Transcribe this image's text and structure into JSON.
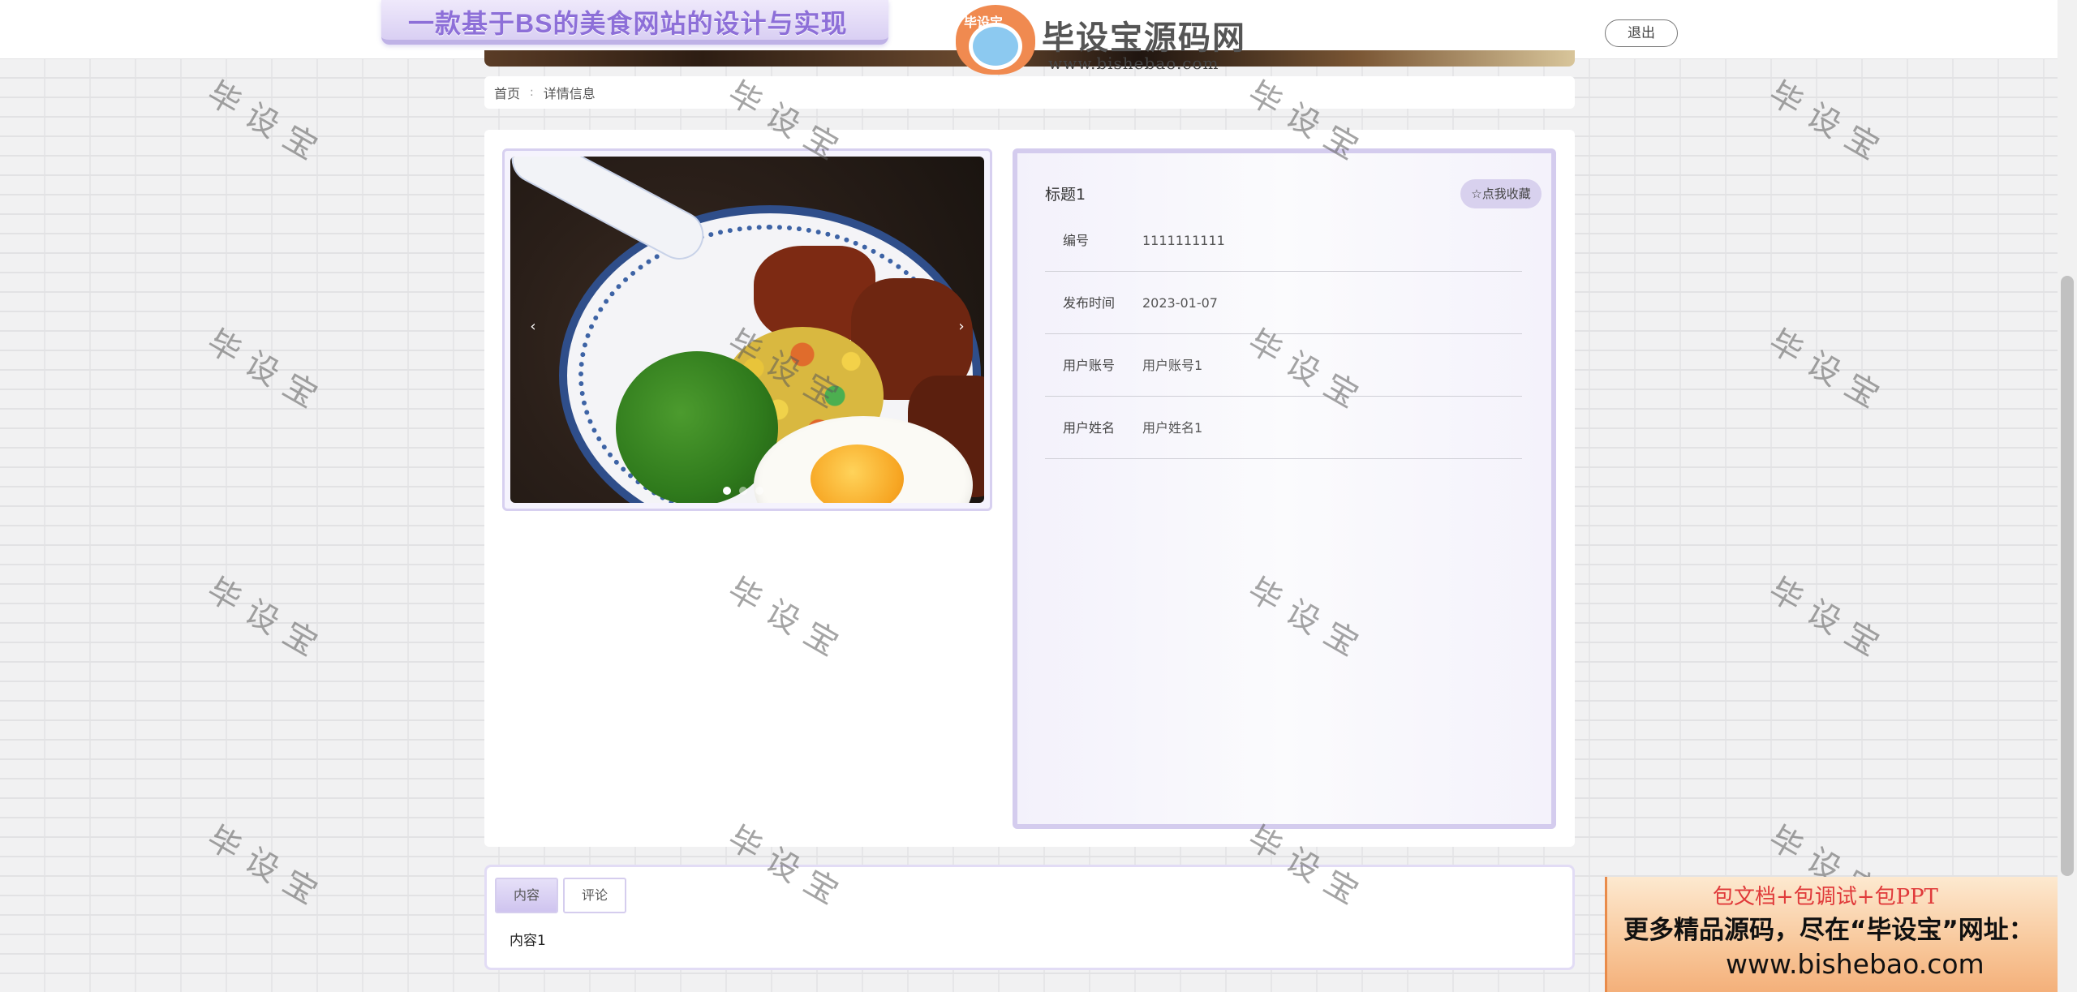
{
  "header": {
    "site_title": "一款基于BS的美食网站的设计与实现",
    "logout_label": "退出"
  },
  "watermark_logo": {
    "tag": "毕设宝",
    "name": "毕设宝源码网",
    "url": "www.bishebao.com"
  },
  "breadcrumb": {
    "home": "首页",
    "separator": ":",
    "current": "详情信息"
  },
  "carousel": {
    "prev_icon": "‹",
    "next_icon": "›",
    "slide_count": 3,
    "active_slide": 1
  },
  "detail": {
    "title": "标题1",
    "favorite_label": "☆点我收藏",
    "fields": [
      {
        "label": "编号",
        "value": "1111111111"
      },
      {
        "label": "发布时间",
        "value": "2023-01-07"
      },
      {
        "label": "用户账号",
        "value": "用户账号1"
      },
      {
        "label": "用户姓名",
        "value": "用户姓名1"
      }
    ]
  },
  "tabs": {
    "items": [
      {
        "label": "内容",
        "active": true
      },
      {
        "label": "评论",
        "active": false
      }
    ],
    "content": "内容1"
  },
  "watermark_text": "毕设宝",
  "promo": {
    "line1": "包文档+包调试+包PPT",
    "line2": "更多精品源码，尽在“毕设宝”网址：",
    "line3": "www.bishebao.com"
  },
  "colors": {
    "accent_lavender": "#d4ccee",
    "promo_red": "#e03a3a"
  }
}
